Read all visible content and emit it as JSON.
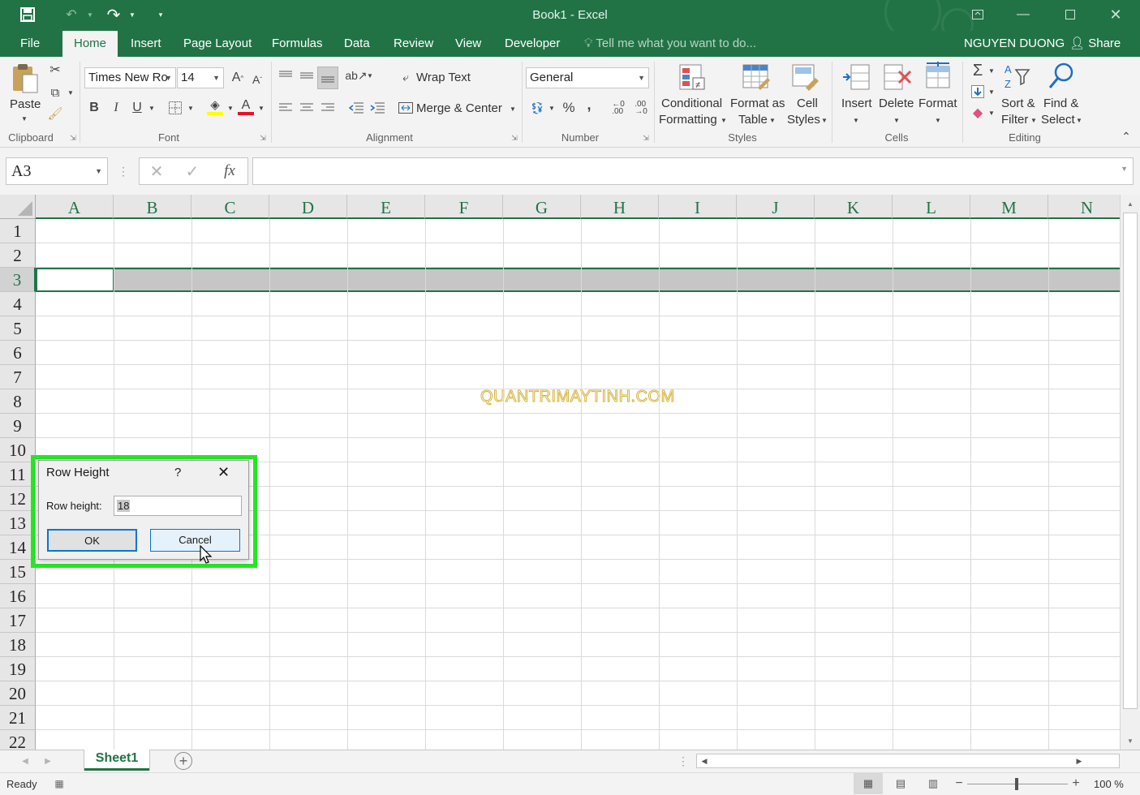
{
  "window": {
    "title": "Book1 - Excel",
    "user": "NGUYEN DUONG",
    "share_label": "Share"
  },
  "tabs": [
    "File",
    "Home",
    "Insert",
    "Page Layout",
    "Formulas",
    "Data",
    "Review",
    "View",
    "Developer"
  ],
  "active_tab": "Home",
  "tell_me": "Tell me what you want to do...",
  "ribbon": {
    "clipboard": {
      "label": "Clipboard",
      "paste": "Paste"
    },
    "font": {
      "label": "Font",
      "name": "Times New Ro",
      "size": "14",
      "bold": "B",
      "italic": "I",
      "underline": "U"
    },
    "alignment": {
      "label": "Alignment",
      "wrap_text": "Wrap Text",
      "merge_center": "Merge & Center"
    },
    "number": {
      "label": "Number",
      "format": "General",
      "percent": "%",
      "comma": ","
    },
    "styles": {
      "label": "Styles",
      "conditional_1": "Conditional",
      "conditional_2": "Formatting",
      "format_table_1": "Format as",
      "format_table_2": "Table",
      "cell_styles_1": "Cell",
      "cell_styles_2": "Styles"
    },
    "cells": {
      "label": "Cells",
      "insert": "Insert",
      "delete": "Delete",
      "format": "Format"
    },
    "editing": {
      "label": "Editing",
      "sort_1": "Sort &",
      "sort_2": "Filter",
      "find_1": "Find &",
      "find_2": "Select"
    }
  },
  "formula_bar": {
    "name_box": "A3",
    "fx": "fx",
    "value": ""
  },
  "grid": {
    "columns": [
      "A",
      "B",
      "C",
      "D",
      "E",
      "F",
      "G",
      "H",
      "I",
      "J",
      "K",
      "L",
      "M",
      "N"
    ],
    "rows": [
      "1",
      "2",
      "3",
      "4",
      "5",
      "6",
      "7",
      "8",
      "9",
      "10",
      "11",
      "12",
      "13",
      "14",
      "15",
      "16",
      "17",
      "18",
      "19",
      "20",
      "21",
      "22"
    ],
    "selected_row": "3",
    "active_cell": "A3"
  },
  "watermark": "QUANTRIMAYTINH.COM",
  "dialog": {
    "title": "Row Height",
    "help": "?",
    "label": "Row height:",
    "value": "18",
    "ok": "OK",
    "cancel": "Cancel"
  },
  "sheets": [
    "Sheet1"
  ],
  "status": {
    "text": "Ready",
    "zoom": "100 %"
  },
  "colors": {
    "accent": "#217346",
    "highlight": "#22e822",
    "selected_row": "#c6c6c6"
  }
}
